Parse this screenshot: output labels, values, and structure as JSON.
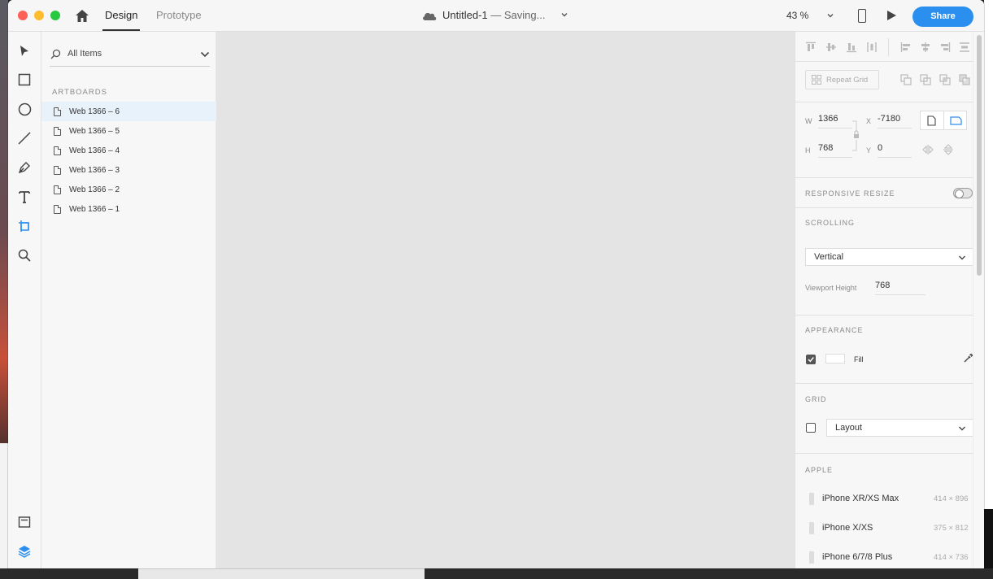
{
  "app": {
    "tabs": {
      "design": "Design",
      "prototype": "Prototype"
    },
    "document_title": "Untitled-1",
    "status": "— Saving...",
    "zoom": "43 %",
    "share_label": "Share"
  },
  "layers": {
    "filter_label": "All Items",
    "section_label": "ARTBOARDS",
    "artboards": [
      {
        "label": "Web 1366 – 6",
        "selected": true
      },
      {
        "label": "Web 1366 – 5",
        "selected": false
      },
      {
        "label": "Web 1366 – 4",
        "selected": false
      },
      {
        "label": "Web 1366 – 3",
        "selected": false
      },
      {
        "label": "Web 1366 – 2",
        "selected": false
      },
      {
        "label": "Web 1366 – 1",
        "selected": false
      }
    ]
  },
  "inspector": {
    "repeat_grid_label": "Repeat Grid",
    "transform": {
      "w_label": "W",
      "w_value": "1366",
      "h_label": "H",
      "h_value": "768",
      "x_label": "X",
      "x_value": "-7180",
      "y_label": "Y",
      "y_value": "0"
    },
    "responsive_resize": {
      "label": "RESPONSIVE RESIZE",
      "enabled": false
    },
    "scrolling": {
      "title": "SCROLLING",
      "mode": "Vertical",
      "viewport_height_label": "Viewport Height",
      "viewport_height": "768"
    },
    "appearance": {
      "title": "APPEARANCE",
      "fill_label": "Fill",
      "fill_checked": true,
      "fill_color": "#ffffff"
    },
    "grid": {
      "title": "GRID",
      "type": "Layout",
      "checked": false
    },
    "apple": {
      "title": "APPLE",
      "devices": [
        {
          "name": "iPhone XR/XS Max",
          "size": "414 × 896"
        },
        {
          "name": "iPhone X/XS",
          "size": "375 × 812"
        },
        {
          "name": "iPhone 6/7/8 Plus",
          "size": "414 × 736"
        }
      ]
    }
  },
  "colors": {
    "accent": "#2b8ff0",
    "selected_row": "#e8f2fb",
    "canvas": "#e4e4e4"
  }
}
